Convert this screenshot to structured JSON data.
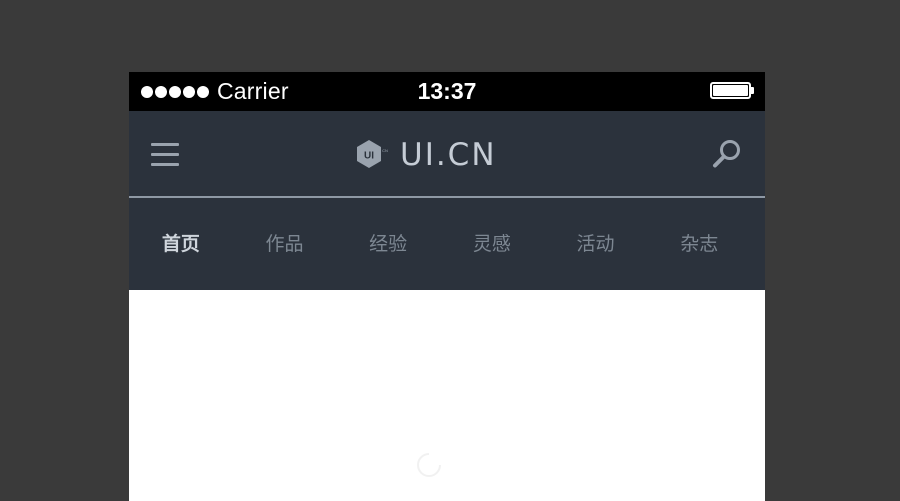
{
  "status_bar": {
    "carrier": "Carrier",
    "time": "13:37",
    "signal_bars": 5
  },
  "header": {
    "logo_badge": "UI",
    "logo_text": "UI.CN",
    "menu_icon": "hamburger-menu-icon",
    "search_icon": "search-icon"
  },
  "tabs": [
    {
      "label": "首页",
      "active": true
    },
    {
      "label": "作品",
      "active": false
    },
    {
      "label": "经验",
      "active": false
    },
    {
      "label": "灵感",
      "active": false
    },
    {
      "label": "活动",
      "active": false
    },
    {
      "label": "杂志",
      "active": false
    }
  ],
  "colors": {
    "background": "#3a3a3a",
    "status_bar": "#000000",
    "nav_background": "#2b323c",
    "divider": "#8e98a4",
    "tab_active": "#cfd5dc",
    "tab_inactive": "#7d8792",
    "logo": "#c5ccd5",
    "content": "#ffffff"
  }
}
